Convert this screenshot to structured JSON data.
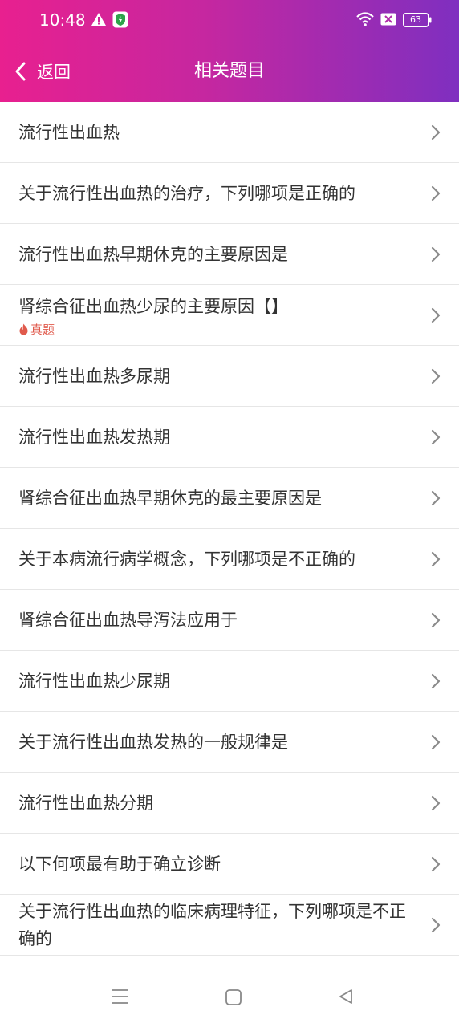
{
  "status_bar": {
    "time": "10:48",
    "battery": "63"
  },
  "header": {
    "back_label": "返回",
    "title": "相关题目"
  },
  "items": [
    {
      "label": "流行性出血热"
    },
    {
      "label": "关于流行性出血热的治疗，下列哪项是正确的"
    },
    {
      "label": "流行性出血热早期休克的主要原因是"
    },
    {
      "label": "肾综合征出血热少尿的主要原因【】",
      "badge": "真题"
    },
    {
      "label": "流行性出血热多尿期"
    },
    {
      "label": "流行性出血热发热期"
    },
    {
      "label": "肾综合征出血热早期休克的最主要原因是"
    },
    {
      "label": "关于本病流行病学概念，下列哪项是不正确的"
    },
    {
      "label": "肾综合征出血热导泻法应用于"
    },
    {
      "label": "流行性出血热少尿期"
    },
    {
      "label": "关于流行性出血热发热的一般规律是"
    },
    {
      "label": "流行性出血热分期"
    },
    {
      "label": "以下何项最有助于确立诊断"
    },
    {
      "label": "关于流行性出血热的临床病理特征，下列哪项是不正确的"
    }
  ],
  "colors": {
    "header_gradient_start": "#e8208f",
    "header_gradient_end": "#7f2fc0",
    "badge": "#e05a4c"
  }
}
